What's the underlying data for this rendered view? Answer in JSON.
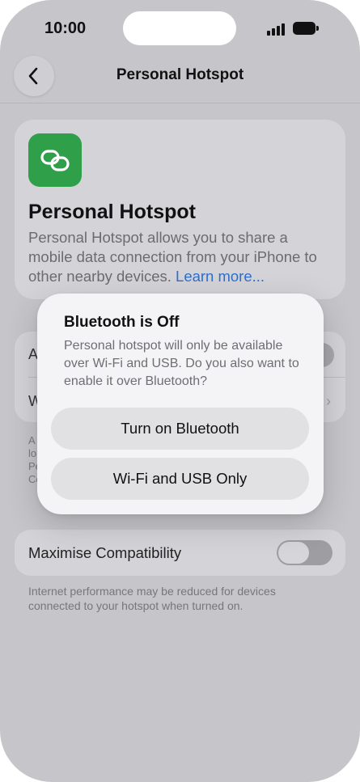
{
  "status_bar": {
    "time": "10:00"
  },
  "nav": {
    "title": "Personal Hotspot"
  },
  "info_card": {
    "title": "Personal Hotspot",
    "description": "Personal Hotspot allows you to share a mobile data connection from your iPhone to other nearby devices.",
    "link": "Learn more..."
  },
  "settings_group": {
    "rows": [
      {
        "label_partial": "A"
      },
      {
        "label_partial": "W"
      }
    ],
    "note_partial": [
      "A",
      "lo",
      "Pe",
      "Co"
    ]
  },
  "maximise": {
    "label": "Maximise Compatibility",
    "enabled": false,
    "footer": "Internet performance may be reduced for devices connected to your hotspot when turned on."
  },
  "alert": {
    "title": "Bluetooth is Off",
    "message": "Personal hotspot will only be available over Wi-Fi and USB. Do you also want to enable it over Bluetooth?",
    "primary_button": "Turn on Bluetooth",
    "secondary_button": "Wi-Fi and USB Only"
  },
  "icons": {
    "back": "chevron-left-icon",
    "app": "link-chain-icon",
    "signal": "cellular-signal-icon",
    "battery": "battery-icon"
  },
  "colors": {
    "accent_link": "#2c6fd0",
    "app_icon_green": "#2f9f4a"
  }
}
